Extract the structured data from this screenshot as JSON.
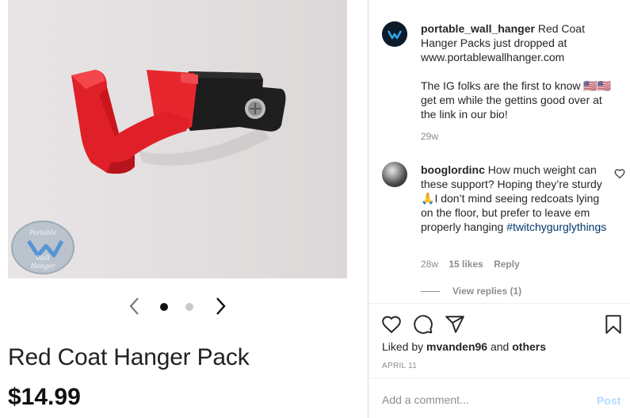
{
  "product": {
    "title": "Red Coat Hanger Pack",
    "price": "$14.99",
    "watermark": {
      "top": "Portable",
      "mid": "Wall",
      "bottom": "Hanger"
    },
    "carousel": {
      "current_slide": 1,
      "total_slides": 2,
      "prev_icon": "chevron-left-icon",
      "next_icon": "chevron-right-icon"
    }
  },
  "post": {
    "owner_username": "portable_wall_hanger",
    "caption_text": "Red Coat Hanger Packs just dropped at",
    "caption_link": "www.portablewallhanger.com",
    "caption_line2_a": "The IG folks are the first to know",
    "caption_flags": "🇺🇸🇺🇸",
    "caption_line2_b": "get em while the gettins good over at the link in our bio!",
    "age": "29w",
    "comment": {
      "username": "booglordinc",
      "text_a": "How much weight can these support? Hoping they’re sturdy",
      "emoji": "🙏",
      "text_b": "I don’t mind seeing redcoats lying on the floor, but prefer to leave em properly hanging",
      "hashtag": "#twitchygurglythings",
      "age": "28w",
      "likes": "15 likes",
      "reply": "Reply",
      "view_replies": "View replies (1)"
    },
    "liked_by_prefix": "Liked by",
    "liked_by_user": "mvanden96",
    "liked_by_and": "and",
    "liked_by_others": "others",
    "date": "APRIL 11",
    "add_comment_placeholder": "Add a comment...",
    "post_button": "Post"
  },
  "colors": {
    "hanger_red": "#e8262e",
    "mount_black": "#1c1c1c",
    "link_blue": "#00376b",
    "post_button_blue": "#b3dbff",
    "muted_text": "#8e8e8e"
  },
  "icons": [
    "heart-icon",
    "comment-icon",
    "share-icon",
    "bookmark-icon",
    "comment-heart-icon"
  ]
}
